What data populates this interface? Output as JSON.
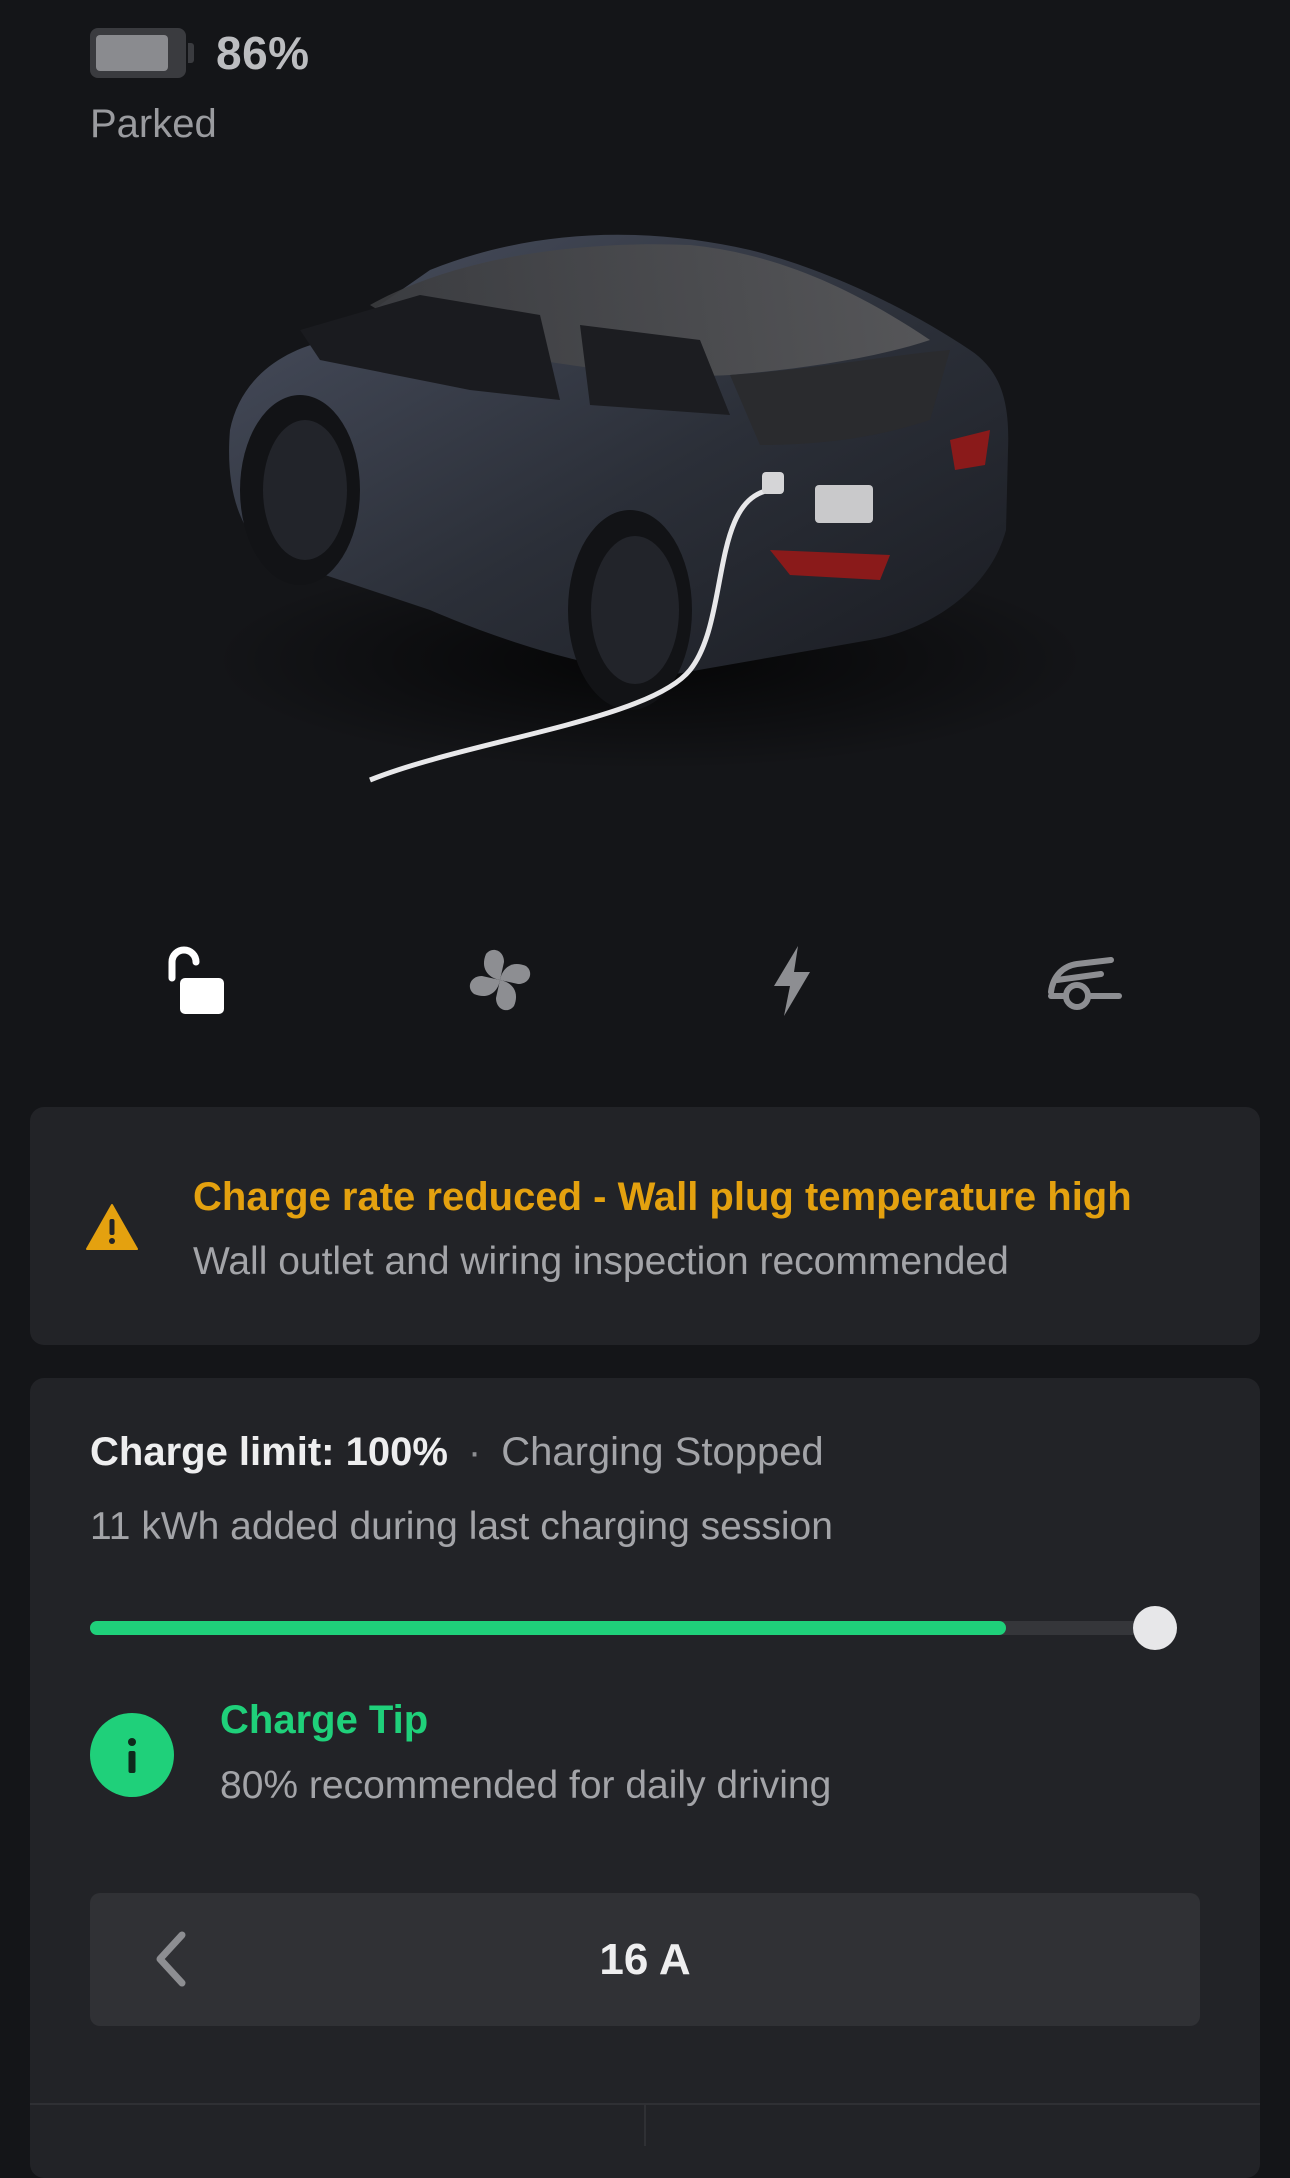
{
  "vehicle": {
    "battery_percent": "86%",
    "battery_level": 0.86,
    "state": "Parked"
  },
  "quick_controls": [
    {
      "name": "lock",
      "icon": "unlock-icon",
      "active": true
    },
    {
      "name": "climate",
      "icon": "fan-icon",
      "active": false
    },
    {
      "name": "charging",
      "icon": "lightning-icon",
      "active": false
    },
    {
      "name": "summon",
      "icon": "summon-icon",
      "active": false
    }
  ],
  "alert": {
    "icon": "warning-icon",
    "title": "Charge rate reduced - Wall plug temperature high",
    "subtitle": "Wall outlet and wiring inspection recommended",
    "color": "#e4a10f"
  },
  "charging": {
    "limit_label": "Charge limit: 100%",
    "separator": "·",
    "status": "Charging Stopped",
    "energy_added": "11 kWh added during last charging session",
    "current_charge_fraction": 0.86,
    "limit_fraction": 1.0,
    "accent_color": "#1fd07a",
    "tip": {
      "icon": "info-icon",
      "title": "Charge Tip",
      "text": "80% recommended for daily driving"
    },
    "amperage": {
      "value": "16 A",
      "prev_icon": "chevron-left-icon"
    }
  }
}
